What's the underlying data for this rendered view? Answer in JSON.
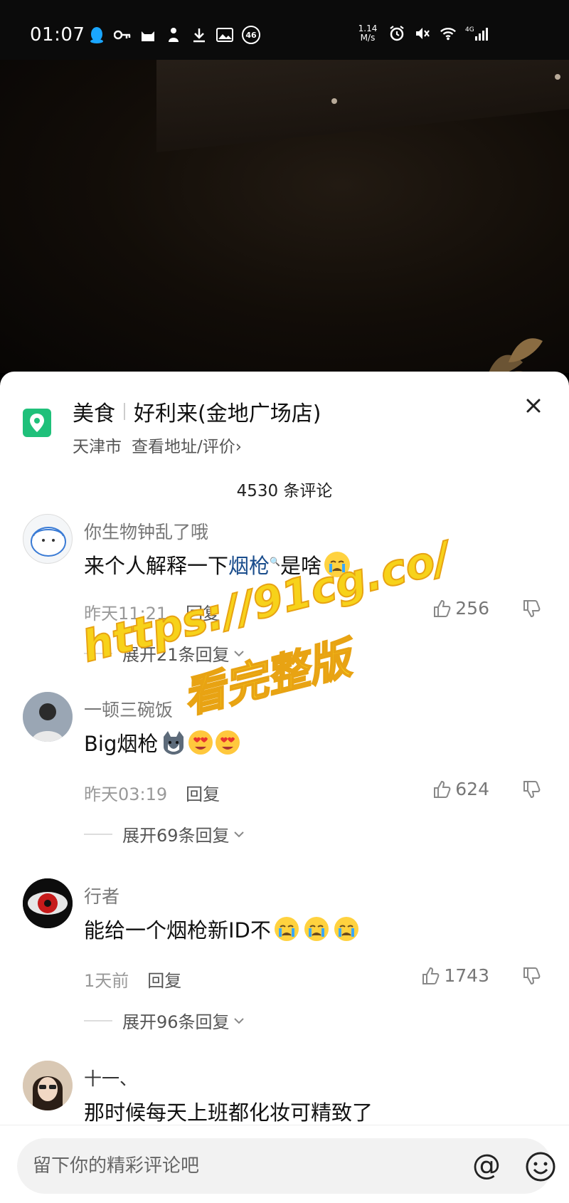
{
  "status_bar": {
    "time": "01:07",
    "net_speed_value": "1.14",
    "net_speed_unit": "M/s",
    "badge": "46",
    "network": "4G"
  },
  "location": {
    "category": "美食",
    "name": "好利来(金地广场店)",
    "city": "天津市",
    "link": "查看地址/评价",
    "link_chevron": "›"
  },
  "comment_count": "4530 条评论",
  "comments": [
    {
      "user": "你生物钟乱了哦",
      "text_before": "来个人解释一下",
      "highlight": "烟枪",
      "search_mark": "🔍",
      "text_after": "是啥",
      "time": "昨天11:21",
      "reply": "回复",
      "likes": "256",
      "expand": "展开21条回复"
    },
    {
      "user": "一顿三碗饭",
      "text": "Big烟枪",
      "time": "昨天03:19",
      "reply": "回复",
      "likes": "624",
      "expand": "展开69条回复"
    },
    {
      "user": "行者",
      "text": "能给一个烟枪新ID不",
      "time": "1天前",
      "reply": "回复",
      "likes": "1743",
      "expand": "展开96条回复"
    },
    {
      "user": "十一、",
      "text": "那时候每天上班都化妆可精致了"
    }
  ],
  "watermark": {
    "line1": "https://91cg.co/",
    "line2": "看完整版"
  },
  "input": {
    "placeholder": "留下你的精彩评论吧",
    "at_symbol": "@"
  },
  "icons": [
    "location-pin-icon",
    "close-icon",
    "thumbs-up-icon",
    "thumbs-down-icon",
    "chevron-down-icon",
    "emoji-icon",
    "at-icon"
  ],
  "colors": {
    "location_green": "#1fc07a",
    "highlight_blue": "#1a4d8c",
    "watermark_yellow": "#f7d21a"
  }
}
